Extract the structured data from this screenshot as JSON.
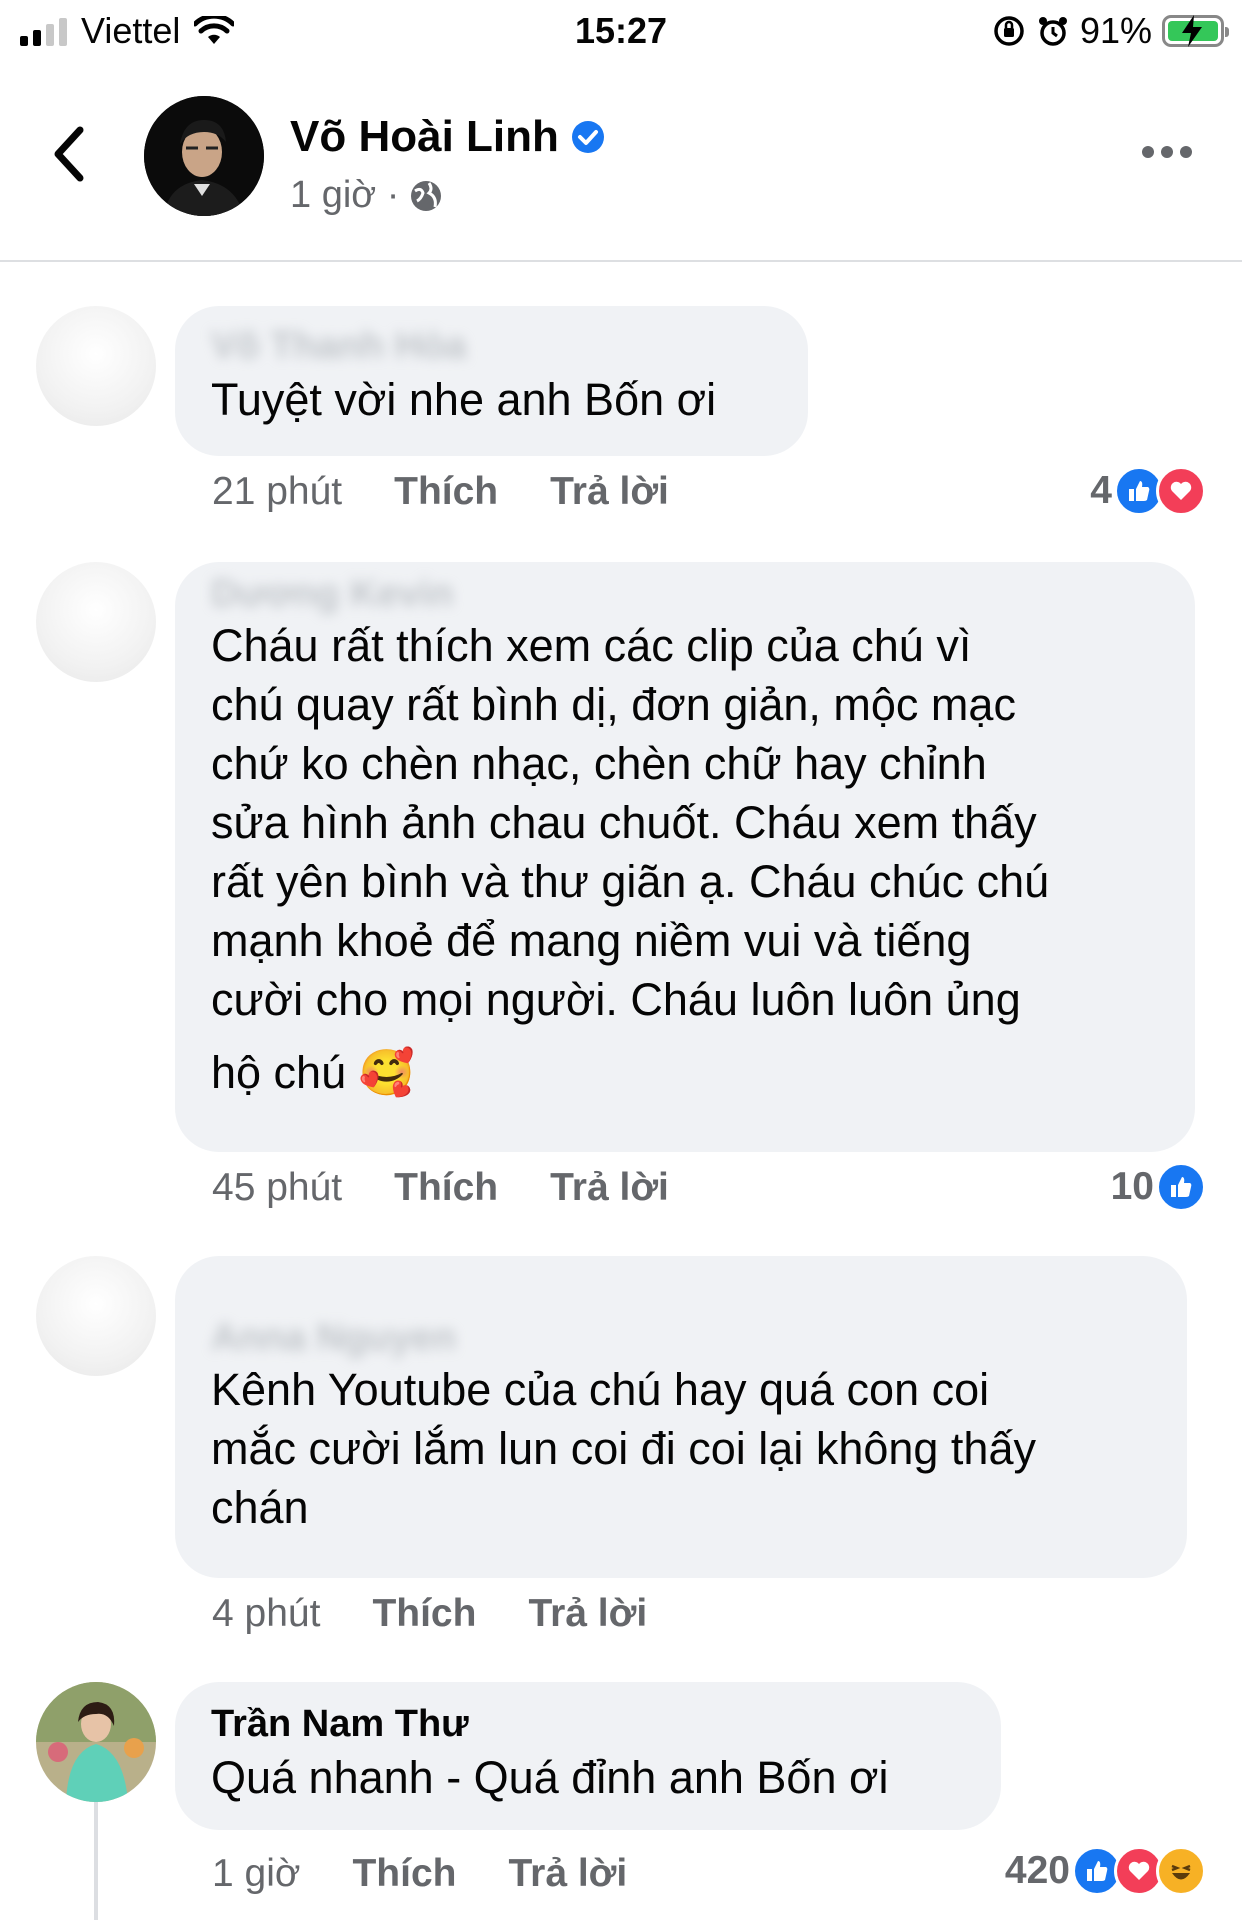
{
  "status_bar": {
    "carrier": "Viettel",
    "time": "15:27",
    "battery": "91%"
  },
  "header": {
    "name": "Võ Hoài Linh",
    "meta": "1 giờ ·",
    "icons": [
      "back-chevron-icon",
      "verified-badge-icon",
      "globe-icon",
      "more-dots-icon"
    ]
  },
  "comments": [
    {
      "author_blurred": "Võ Thanh Hòa",
      "text_lines": [
        "Tuyệt vời nhe anh Bốn ơi"
      ],
      "time": "21 phút",
      "like_label": "Thích",
      "reply_label": "Trả lời",
      "reaction_count": "4",
      "reactions": [
        "like",
        "love"
      ]
    },
    {
      "author_blurred": "Dương Kevin",
      "text_lines": [
        "Cháu rất thích xem các clip của chú vì",
        "chú quay rất bình dị, đơn giản, mộc mạc",
        "chứ ko chèn nhạc, chèn chữ hay chỉnh",
        "sửa hình ảnh chau chuốt. Cháu xem thấy",
        "rất yên bình và thư giãn ạ. Cháu chúc chú",
        "mạnh khoẻ để mang niềm vui và tiếng",
        "cười cho mọi người. Cháu luôn luôn ủng",
        "hộ chú 🥰"
      ],
      "time": "45 phút",
      "like_label": "Thích",
      "reply_label": "Trả lời",
      "reaction_count": "10",
      "reactions": [
        "like"
      ]
    },
    {
      "author_blurred": "Anna Nguyen",
      "text_lines": [
        "Kênh Youtube của chú hay quá con coi",
        "mắc cười lắm lun coi đi coi lại không thấy",
        "chán"
      ],
      "time": "4 phút",
      "like_label": "Thích",
      "reply_label": "Trả lời"
    },
    {
      "author": "Trần Nam Thư",
      "text_lines": [
        "Quá nhanh - Quá đỉnh anh Bốn ơi"
      ],
      "time": "1 giờ",
      "like_label": "Thích",
      "reply_label": "Trả lời",
      "reaction_count": "420",
      "reactions": [
        "like",
        "love",
        "haha"
      ]
    }
  ],
  "colors": {
    "accent": "#1877f2",
    "bubble": "#f0f2f5",
    "secondary_text": "#65676b",
    "love": "#f33e58",
    "haha": "#f7b125"
  }
}
